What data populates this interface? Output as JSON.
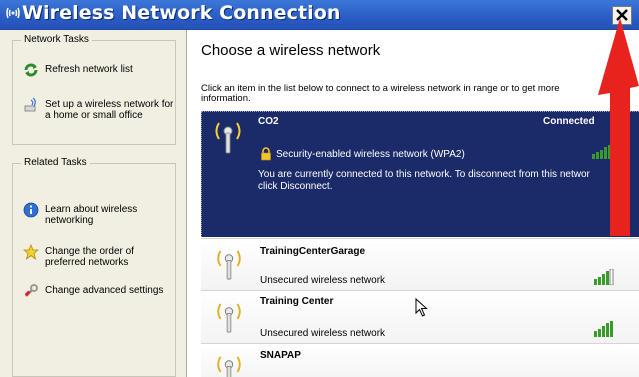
{
  "window": {
    "title": "Wireless Network Connection"
  },
  "sidebar": {
    "network_tasks": {
      "title": "Network Tasks",
      "items": [
        {
          "label": "Refresh network list",
          "icon": "refresh-icon"
        },
        {
          "label": "Set up a wireless network for a home or small office",
          "icon": "setup-wizard-icon"
        }
      ]
    },
    "related_tasks": {
      "title": "Related Tasks",
      "items": [
        {
          "label": "Learn about wireless networking",
          "icon": "info-icon"
        },
        {
          "label": "Change the order of preferred networks",
          "icon": "star-icon"
        },
        {
          "label": "Change advanced settings",
          "icon": "settings-icon"
        }
      ]
    }
  },
  "main": {
    "title": "Choose a wireless network",
    "description": "Click an item in the list below to connect to a wireless network in range or to get more information."
  },
  "networks": [
    {
      "name": "CO2",
      "status": "Connected",
      "security": "Security-enabled wireless network (WPA2)",
      "message_line1": "You are currently connected to this network. To disconnect from this networ",
      "message_line2": "click Disconnect."
    },
    {
      "name": "TrainingCenterGarage",
      "security": "Unsecured wireless network"
    },
    {
      "name": "Training Center",
      "security": "Unsecured wireless network"
    },
    {
      "name": "SNAPAP",
      "security": ""
    }
  ],
  "colors": {
    "titlebar": "#2a5cc4",
    "selected_row": "#1b2a68",
    "sidebar": "#f1efe2",
    "signal_green": "#3a9a2a",
    "annotation_arrow": "#e8231e"
  }
}
